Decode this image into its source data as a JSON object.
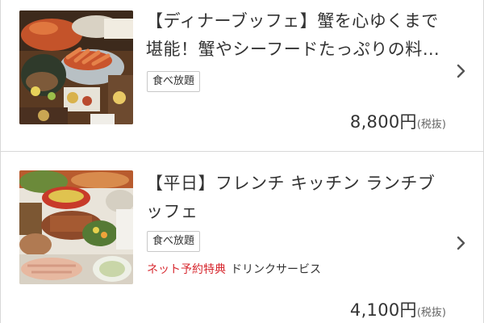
{
  "plans": [
    {
      "title": "【ディナーブッフェ】蟹を心ゆくまで堪能！蟹やシーフードたっぷりの料理…",
      "tag": "食べ放題",
      "price": "8,800円",
      "tax_note": "(税抜)",
      "image_icon": "crab-buffet-photo"
    },
    {
      "title": "【平日】フレンチ キッチン ランチブッフェ",
      "tag": "食べ放題",
      "perk_label": "ネット予約特典",
      "perk_text": "ドリンクサービス",
      "price": "4,100円",
      "tax_note": "(税抜)",
      "image_icon": "lunch-buffet-photo"
    }
  ],
  "icons": {
    "chevron": "chevron-right-icon"
  },
  "colors": {
    "perk_label": "#d7282f",
    "divider": "#d8d8d8",
    "text": "#333333"
  }
}
